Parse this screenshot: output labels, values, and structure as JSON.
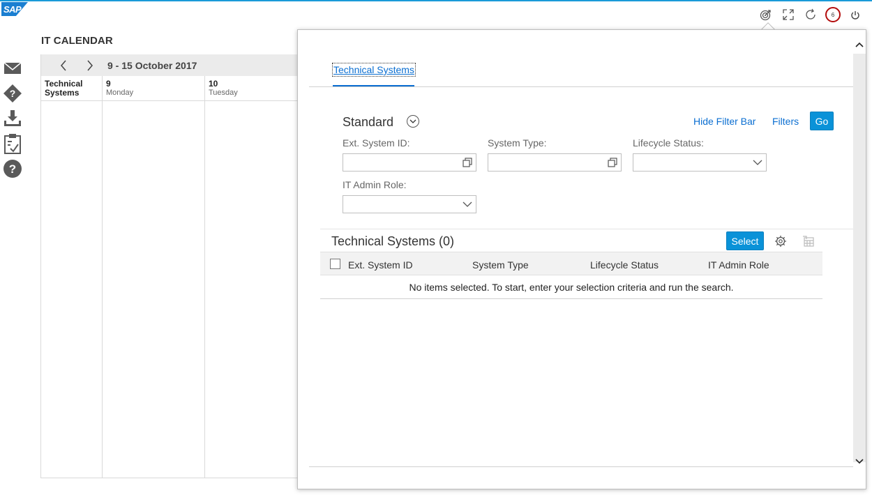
{
  "brand": {
    "logo_text": "SAP",
    "accent": "#0a6ed1",
    "button_blue": "#0a92d8"
  },
  "header": {
    "notification_count": "6"
  },
  "page": {
    "title": "IT CALENDAR"
  },
  "calendar": {
    "range": "9 - 15 October 2017",
    "columns": [
      {
        "label1": "Technical",
        "label2": "Systems"
      },
      {
        "day": "9",
        "weekday": "Monday"
      },
      {
        "day": "10",
        "weekday": "Tuesday"
      }
    ]
  },
  "panel": {
    "tab_label": "Technical Systems",
    "filter_bar": {
      "variant": "Standard",
      "hide_filter_bar": "Hide Filter Bar",
      "filters": "Filters",
      "go": "Go",
      "fields": {
        "ext_system_id": {
          "label": "Ext. System ID:",
          "value": ""
        },
        "system_type": {
          "label": "System Type:",
          "value": ""
        },
        "lifecycle_status": {
          "label": "Lifecycle Status:",
          "value": ""
        },
        "it_admin_role": {
          "label": "IT Admin Role:",
          "value": ""
        }
      }
    },
    "table": {
      "title": "Technical Systems (0)",
      "select_label": "Select",
      "columns": [
        "Ext. System ID",
        "System Type",
        "Lifecycle Status",
        "IT Admin Role"
      ],
      "empty_text": "No items selected. To start, enter your selection criteria and run the search."
    }
  },
  "icons": {
    "header": [
      "target-icon",
      "expand-icon",
      "refresh-icon",
      "notifications-icon",
      "power-icon"
    ],
    "left": [
      "mail-icon",
      "help-diamond-icon",
      "download-icon",
      "clipboard-check-icon",
      "question-icon"
    ]
  }
}
